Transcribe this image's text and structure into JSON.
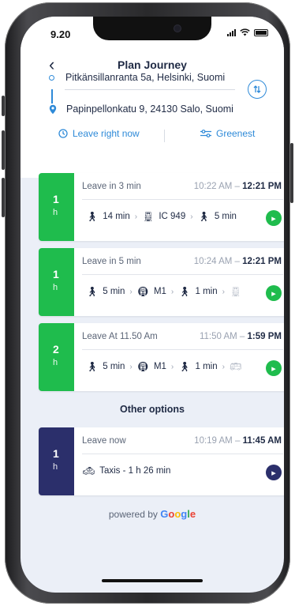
{
  "status": {
    "time": "9.20"
  },
  "header": {
    "title": "Plan Journey",
    "from": "Pitkänsillanranta 5a, Helsinki, Suomi",
    "to": "Papinpellonkatu 9, 24130 Salo, Suomi",
    "leave_option": "Leave right now",
    "sort_option": "Greenest"
  },
  "journeys": [
    {
      "duration": "1",
      "unit": "h",
      "leave": "Leave in 3 min",
      "depart": "10:22 AM",
      "arrive": "12:21 PM",
      "legs": [
        {
          "icon": "walk-icon",
          "label": "14 min"
        },
        {
          "icon": "train-icon",
          "label": "IC 949"
        },
        {
          "icon": "walk-icon",
          "label": "5 min"
        }
      ]
    },
    {
      "duration": "1",
      "unit": "h",
      "leave": "Leave in 5 min",
      "depart": "10:24 AM",
      "arrive": "12:21 PM",
      "legs": [
        {
          "icon": "walk-icon",
          "label": "5 min"
        },
        {
          "icon": "metro-icon",
          "label": "M1"
        },
        {
          "icon": "walk-icon",
          "label": "1 min"
        }
      ]
    },
    {
      "duration": "2",
      "unit": "h",
      "leave": "Leave At 11.50 Am",
      "depart": "11:50 AM",
      "arrive": "1:59 PM",
      "legs": [
        {
          "icon": "walk-icon",
          "label": "5 min"
        },
        {
          "icon": "metro-icon",
          "label": "M1"
        },
        {
          "icon": "walk-icon",
          "label": "1 min"
        }
      ]
    }
  ],
  "other": {
    "title": "Other options",
    "duration": "1",
    "unit": "h",
    "leave": "Leave now",
    "depart": "10:19 AM",
    "arrive": "11:45 AM",
    "leg": "Taxis - 1 h 26 min"
  },
  "footer": {
    "powered": "powered by",
    "brand": "Google"
  },
  "colors": {
    "accent": "#2e8ad8",
    "green": "#1fbc4d",
    "navy": "#2b2f6b",
    "bg": "#ebeff7"
  }
}
